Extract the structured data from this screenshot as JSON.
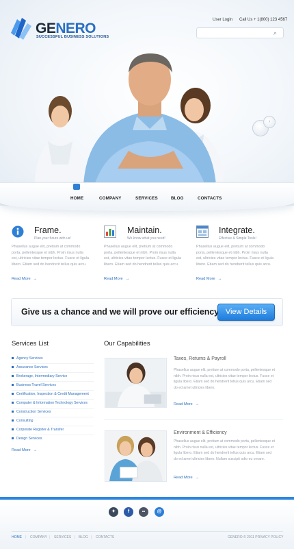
{
  "brand": {
    "logo_prefix": "GE",
    "logo_suffix": "NERO",
    "tagline": "SUCCESSFUL BUSINESS SOLUTIONS"
  },
  "header": {
    "user_login": "User Login",
    "call_us": "Call Us + 1(800) 123 4567",
    "search_placeholder": ""
  },
  "nav": [
    {
      "label": "HOME"
    },
    {
      "label": "COMPANY"
    },
    {
      "label": "SERVICES"
    },
    {
      "label": "BLOG"
    },
    {
      "label": "CONTACTS"
    }
  ],
  "features": [
    {
      "title": "Frame.",
      "subtitle": "Plan your future with us!",
      "icon": "info-icon",
      "text": "Phasellus augue elit, pretium at commodo porta, pellentesque et nibh. Proin risus nulla est, ultricies vitae tempor lectus. Fusce et ligula libero. Etiam sed do hendrerit tellus quis arcu.",
      "more": "Read More",
      "arrow": "→"
    },
    {
      "title": "Maintain.",
      "subtitle": "We know what you need!",
      "icon": "chart-icon",
      "text": "Phasellus augue elit, pretium at commodo porta, pellentesque et nibh. Proin risus nulla est, ultricies vitae tempor lectus. Fusce et ligula libero. Etiam sed do hendrerit tellus quis arcu.",
      "more": "Read More",
      "arrow": "→"
    },
    {
      "title": "Integrate.",
      "subtitle": "Effective & Simple Tools!",
      "icon": "window-icon",
      "text": "Phasellus augue elit, pretium at commodo porta, pellentesque et nibh. Proin risus nulla est, ultricies vitae tempor lectus. Fusce et ligula libero. Etiam sed do hendrerit tellus quis arcu.",
      "more": "Read More",
      "arrow": "→"
    }
  ],
  "banner": {
    "text": "Give us a chance and we will prove our efficiency!",
    "button": "View Details"
  },
  "services": {
    "title": "Services List",
    "items": [
      "Agency Services",
      "Assurance Services",
      "Brokerage, Intermediary Service",
      "Business Travel Services",
      "Certification, Inspection & Credit Management",
      "Computer & Information Technology Services",
      "Construction Services",
      "Consulting",
      "Corporate Register & Transfer",
      "Design Services"
    ],
    "more": "Read More"
  },
  "capabilities": {
    "title": "Our Capabilities",
    "items": [
      {
        "title": "Taxes, Returns & Payroll",
        "text": "Phasellus augue elit, pretium at commodo porta, pellentesque et nibh. Proin risus nulla est, ultricies vitae tempor lectus. Fusce et ligula libero. Etiam sed do hendrerit tellus quis arcu. Etiam sed do ed amet ultricies libero.",
        "more": "Read More",
        "arrow": "→"
      },
      {
        "title": "Environment & Efficiency",
        "text": "Phasellus augue elit, pretium at commodo porta, pellentesque et nibh. Proin risus nulla est, ultricies vitae tempor lectus. Fusce et ligula libero. Etiam sed do hendrerit tellus quis arcu. Etiam sed do ed amet ultricies libero. Nullam suscipit odio eu ornare.",
        "more": "Read More",
        "arrow": "→"
      }
    ]
  },
  "social": [
    {
      "icon": "delicious-icon",
      "glyph": "✦",
      "color": "#3a4a5c"
    },
    {
      "icon": "facebook-icon",
      "glyph": "f",
      "color": "#2d5ba8"
    },
    {
      "icon": "flickr-icon",
      "glyph": "••",
      "color": "#4b5563"
    },
    {
      "icon": "globe-icon",
      "glyph": "@",
      "color": "#2d7fd6"
    }
  ],
  "footer": {
    "links": [
      "HOME",
      "COMPANY",
      "SERVICES",
      "BLOG",
      "CONTACTS"
    ],
    "separator": "|",
    "copyright": "GENERO © 2011  PRIVACY POLICY"
  },
  "colors": {
    "accent": "#2d86e0",
    "link": "#2d6fbe",
    "button": "#1e7cdc"
  }
}
